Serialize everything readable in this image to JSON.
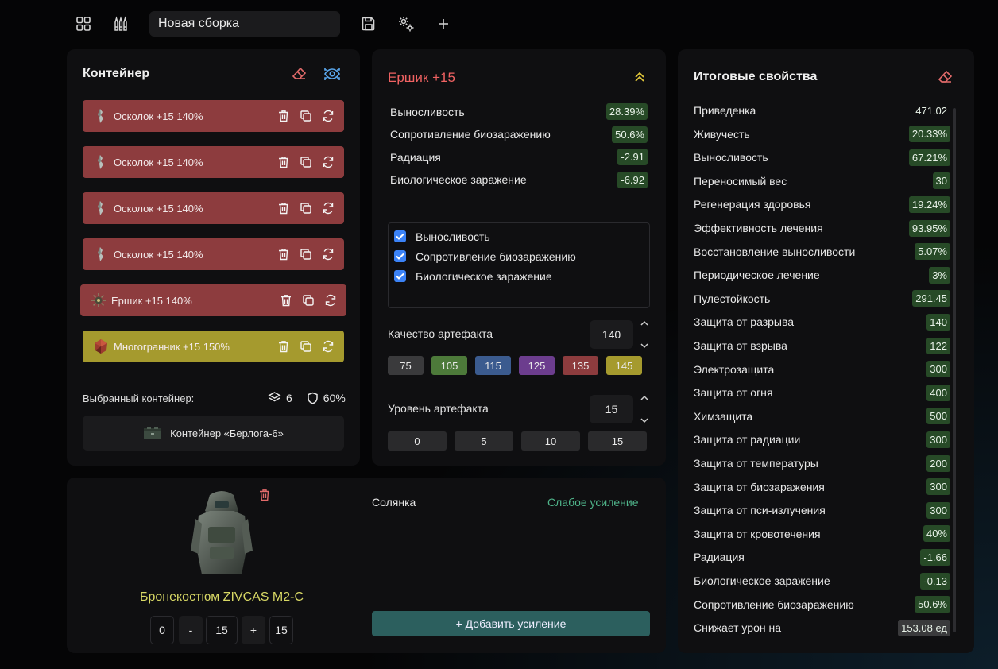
{
  "toolbar": {
    "build_name": "Новая сборка"
  },
  "container_panel": {
    "title": "Контейнер",
    "artifacts": [
      {
        "name": "Осколок +15 140%",
        "color": "red",
        "icon": "shard-icon"
      },
      {
        "name": "Осколок +15 140%",
        "color": "red",
        "icon": "shard-icon"
      },
      {
        "name": "Осколок +15 140%",
        "color": "red",
        "icon": "shard-icon"
      },
      {
        "name": "Осколок +15 140%",
        "color": "red",
        "icon": "shard-icon"
      },
      {
        "name": "Ершик +15 140%",
        "color": "red",
        "icon": "spiky-ball-icon"
      },
      {
        "name": "Многогранник +15 150%",
        "color": "yellow",
        "icon": "polyhedron-icon"
      }
    ],
    "selected_label": "Выбранный контейнер:",
    "slots": "6",
    "protection": "60%",
    "container_name": "Контейнер «Берлога-6»"
  },
  "artifact_panel": {
    "title": "Ершик +15",
    "stats": [
      {
        "name": "Выносливость",
        "value": "28.39%"
      },
      {
        "name": "Сопротивление биозаражению",
        "value": "50.6%"
      },
      {
        "name": "Радиация",
        "value": "-2.91"
      },
      {
        "name": "Биологическое заражение",
        "value": "-6.92"
      }
    ],
    "checks": [
      {
        "label": "Выносливость"
      },
      {
        "label": "Сопротивление биозаражению"
      },
      {
        "label": "Биологическое заражение"
      }
    ],
    "quality_label": "Качество артефакта",
    "quality_value": "140",
    "quality_chips": [
      {
        "label": "75",
        "color": "#3a3a3c"
      },
      {
        "label": "105",
        "color": "#4d7a3a"
      },
      {
        "label": "115",
        "color": "#3b5b8f"
      },
      {
        "label": "125",
        "color": "#6c3d8e"
      },
      {
        "label": "135",
        "color": "#8d3c3e"
      },
      {
        "label": "145",
        "color": "#a59a2e"
      }
    ],
    "level_label": "Уровень артефакта",
    "level_value": "15",
    "level_chips": [
      {
        "label": "0"
      },
      {
        "label": "5"
      },
      {
        "label": "10"
      },
      {
        "label": "15"
      }
    ]
  },
  "properties_panel": {
    "title": "Итоговые свойства",
    "props": [
      {
        "name": "Приведенка",
        "value": "471.02",
        "style": "plain"
      },
      {
        "name": "Живучесть",
        "value": "20.33%",
        "style": "green"
      },
      {
        "name": "Выносливость",
        "value": "67.21%",
        "style": "green"
      },
      {
        "name": "Переносимый вес",
        "value": "30",
        "style": "green"
      },
      {
        "name": "Регенерация здоровья",
        "value": "19.24%",
        "style": "green"
      },
      {
        "name": "Эффективность лечения",
        "value": "93.95%",
        "style": "green"
      },
      {
        "name": "Восстановление выносливости",
        "value": "5.07%",
        "style": "green"
      },
      {
        "name": "Периодическое лечение",
        "value": "3%",
        "style": "green"
      },
      {
        "name": "Пулестойкость",
        "value": "291.45",
        "style": "green"
      },
      {
        "name": "Защита от разрыва",
        "value": "140",
        "style": "green"
      },
      {
        "name": "Защита от взрыва",
        "value": "122",
        "style": "green"
      },
      {
        "name": "Электрозащита",
        "value": "300",
        "style": "green"
      },
      {
        "name": "Защита от огня",
        "value": "400",
        "style": "green"
      },
      {
        "name": "Химзащита",
        "value": "500",
        "style": "green"
      },
      {
        "name": "Защита от радиации",
        "value": "300",
        "style": "green"
      },
      {
        "name": "Защита от температуры",
        "value": "200",
        "style": "green"
      },
      {
        "name": "Защита от биозаражения",
        "value": "300",
        "style": "green"
      },
      {
        "name": "Защита от пси-излучения",
        "value": "300",
        "style": "green"
      },
      {
        "name": "Защита от кровотечения",
        "value": "40%",
        "style": "green"
      },
      {
        "name": "Радиация",
        "value": "-1.66",
        "style": "green"
      },
      {
        "name": "Биологическое заражение",
        "value": "-0.13",
        "style": "green"
      },
      {
        "name": "Сопротивление биозаражению",
        "value": "50.6%",
        "style": "green"
      },
      {
        "name": "Снижает урон на",
        "value": "153.08 ед",
        "style": "grey"
      }
    ]
  },
  "armor_panel": {
    "armor_name": "Бронекостюм ZIVCAS M2-C",
    "min": "0",
    "minus": "-",
    "level": "15",
    "plus": "+",
    "max": "15",
    "boost_label": "Солянка",
    "boost_value": "Слабое усиление",
    "add_boost": "+ Добавить усиление"
  }
}
